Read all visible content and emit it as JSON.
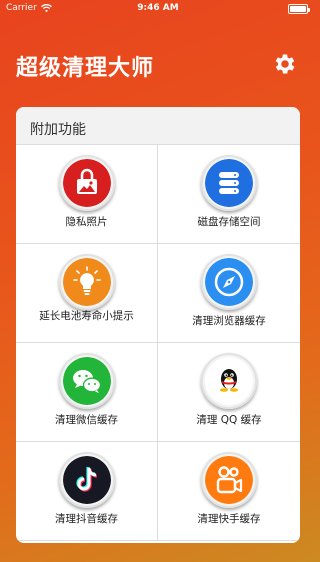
{
  "status_bar": {
    "carrier": "Carrier",
    "time": "9:46 AM",
    "battery_level": 1.0
  },
  "header": {
    "title": "超级清理大师",
    "settings_icon": "gear-icon"
  },
  "section": {
    "title": "附加功能"
  },
  "items": [
    {
      "label": "隐私照片",
      "icon": "lock-photo-icon",
      "color": "#d81f1f"
    },
    {
      "label": "磁盘存储空间",
      "icon": "database-icon",
      "color": "#1f6fe0"
    },
    {
      "label": "延长电池寿命小提示",
      "icon": "lightbulb-icon",
      "color": "#f08a1a"
    },
    {
      "label": "清理浏览器缓存",
      "icon": "compass-icon",
      "color": "#2a8ff0"
    },
    {
      "label": "清理微信缓存",
      "icon": "wechat-icon",
      "color": "#22b53a"
    },
    {
      "label": "清理 QQ 缓存",
      "icon": "qq-penguin-icon",
      "color": "#ffffff"
    },
    {
      "label": "清理抖音缓存",
      "icon": "tiktok-icon",
      "color": "#161823"
    },
    {
      "label": "清理快手缓存",
      "icon": "kuaishou-icon",
      "color": "#ff7a0f"
    }
  ]
}
